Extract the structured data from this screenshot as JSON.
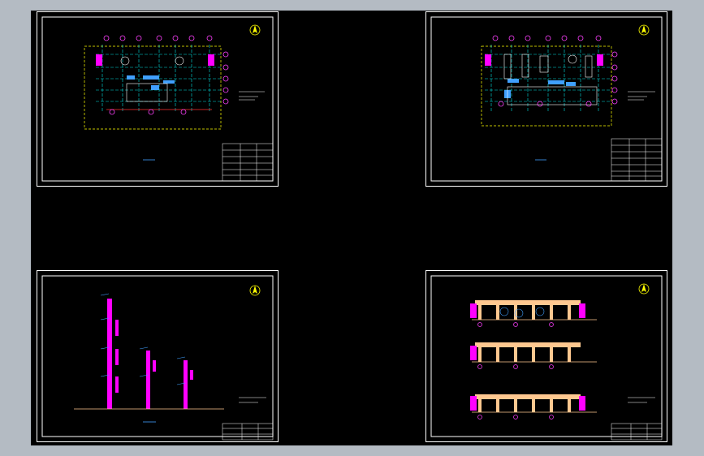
{
  "window": {
    "background_color": "#b4bbc3",
    "viewport_color": "#000000"
  },
  "colors": {
    "border": "#ffffff",
    "grid_line": "#00e0e0",
    "axis_bubble": "#ff40ff",
    "wall": "#ff00ff",
    "beam": "#ffc890",
    "dim_line": "#ffff00",
    "text": "#ffffff",
    "accent_blue": "#40a0ff",
    "red_line": "#ff3030",
    "north_arrow": "#ffff00"
  },
  "icons": {
    "north_arrow": "north-arrow-icon"
  },
  "sheets": [
    {
      "id": "plan-1",
      "kind": "floor-plan",
      "label": "sheet-floor-plan-1"
    },
    {
      "id": "plan-2",
      "kind": "floor-plan",
      "label": "sheet-floor-plan-2"
    },
    {
      "id": "section",
      "kind": "wall-section",
      "label": "sheet-wall-section"
    },
    {
      "id": "elevations",
      "kind": "elevations",
      "label": "sheet-elevations"
    }
  ]
}
